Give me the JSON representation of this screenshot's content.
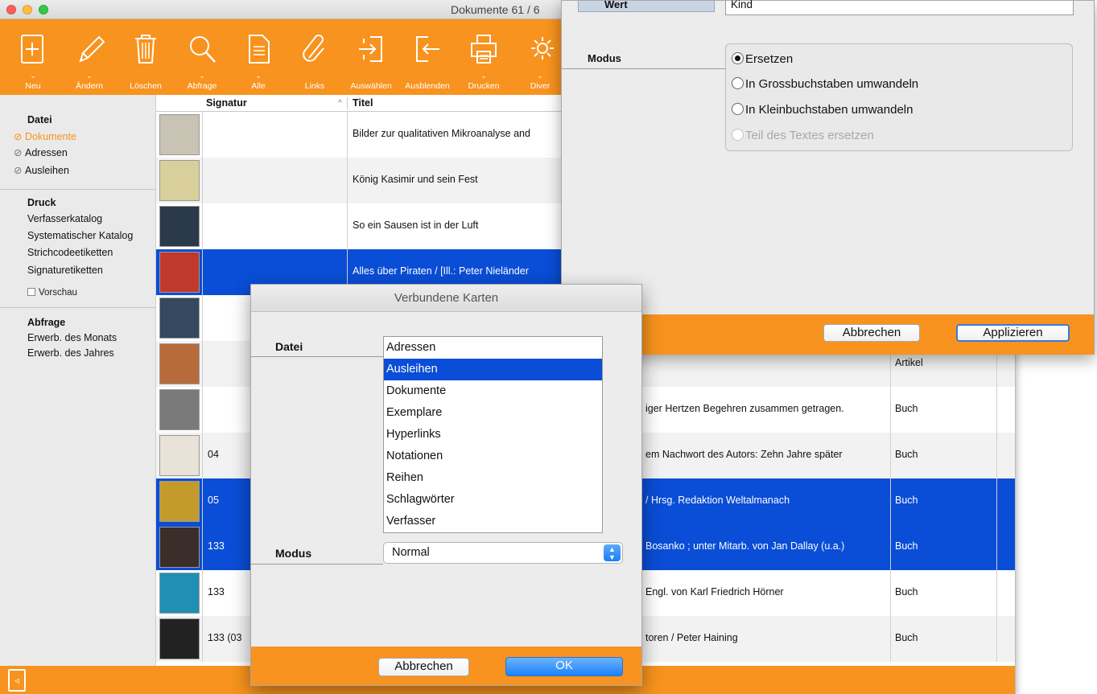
{
  "window": {
    "title": "Dokumente  61 / 6"
  },
  "toolbar": {
    "items": [
      {
        "label": "Neu",
        "icon": "plus-page-icon"
      },
      {
        "label": "Ändern",
        "icon": "pencil-icon"
      },
      {
        "label": "Löschen",
        "icon": "trash-icon"
      },
      {
        "label": "Abfrage",
        "icon": "magnifier-icon"
      },
      {
        "label": "Alle",
        "icon": "document-icon"
      },
      {
        "label": "Links",
        "icon": "paperclip-icon"
      },
      {
        "label": "Auswählen",
        "icon": "select-arrow-icon"
      },
      {
        "label": "Ausblenden",
        "icon": "hide-arrow-icon"
      },
      {
        "label": "Drucken",
        "icon": "printer-icon"
      },
      {
        "label": "Diver",
        "icon": "gear-icon"
      }
    ]
  },
  "sidebar": {
    "datei_header": "Datei",
    "datei_items": [
      "Dokumente",
      "Adressen",
      "Ausleihen"
    ],
    "druck_header": "Druck",
    "druck_items": [
      "Verfasserkatalog",
      "Systematischer Katalog",
      "Strichcodeetiketten",
      "Signaturetiketten"
    ],
    "preview_label": "Vorschau",
    "abfrage_header": "Abfrage",
    "abfrage_items": [
      "Erwerb. des Monats",
      "Erwerb. des Jahres"
    ]
  },
  "table": {
    "columns": {
      "signatur": "Signatur",
      "sort_indicator": "^",
      "titel": "Titel"
    },
    "rows": [
      {
        "signatur": "",
        "titel": "Bilder zur qualitativen Mikroanalyse and",
        "typ": ""
      },
      {
        "signatur": "",
        "titel": "König Kasimir und sein Fest",
        "typ": ""
      },
      {
        "signatur": "",
        "titel": "So ein Sausen ist in der Luft",
        "typ": ""
      },
      {
        "signatur": "",
        "titel": "Alles über Piraten / [Ill.: Peter Nieländer",
        "typ": ""
      },
      {
        "signatur": "",
        "titel": "",
        "typ": ""
      },
      {
        "signatur": "",
        "titel": "",
        "typ": "Artikel"
      },
      {
        "signatur": "",
        "titel": "iger Hertzen Begehren zusammen getragen.",
        "typ": "Buch"
      },
      {
        "signatur": "04",
        "titel": "em Nachwort des Autors: Zehn Jahre später",
        "typ": "Buch"
      },
      {
        "signatur": "05",
        "titel": "/ Hrsg. Redaktion Weltalmanach",
        "typ": "Buch"
      },
      {
        "signatur": "133",
        "titel": "Bosanko ; unter Mitarb. von Jan Dallay (u.a.)",
        "typ": "Buch"
      },
      {
        "signatur": "133",
        "titel": "Engl. von Karl Friedrich Hörner",
        "typ": "Buch"
      },
      {
        "signatur": "133 (03",
        "titel": "toren / Peter Haining",
        "typ": "Buch"
      }
    ]
  },
  "replace_dialog": {
    "wert_label": "Wert",
    "wert_value": "Kind",
    "modus_label": "Modus",
    "options": [
      {
        "label": "Ersetzen",
        "checked": true,
        "enabled": true
      },
      {
        "label": "In Grossbuchstaben umwandeln",
        "checked": false,
        "enabled": true
      },
      {
        "label": "In Kleinbuchstaben umwandeln",
        "checked": false,
        "enabled": true
      },
      {
        "label": "Teil des Textes ersetzen",
        "checked": false,
        "enabled": false
      }
    ],
    "cancel_label": "Abbrechen",
    "apply_label": "Applizieren"
  },
  "vk_dialog": {
    "title": "Verbundene Karten",
    "datei_label": "Datei",
    "list": [
      "Adressen",
      "Ausleihen",
      "Dokumente",
      "Exemplare",
      "Hyperlinks",
      "Notationen",
      "Reihen",
      "Schlagwörter",
      "Verfasser"
    ],
    "selected_index": 1,
    "modus_label": "Modus",
    "modus_value": "Normal",
    "cancel_label": "Abbrechen",
    "ok_label": "OK"
  },
  "colors": {
    "accent": "#f7931e",
    "selection": "#0a4dd6",
    "button_blue": "#1a82fb"
  }
}
